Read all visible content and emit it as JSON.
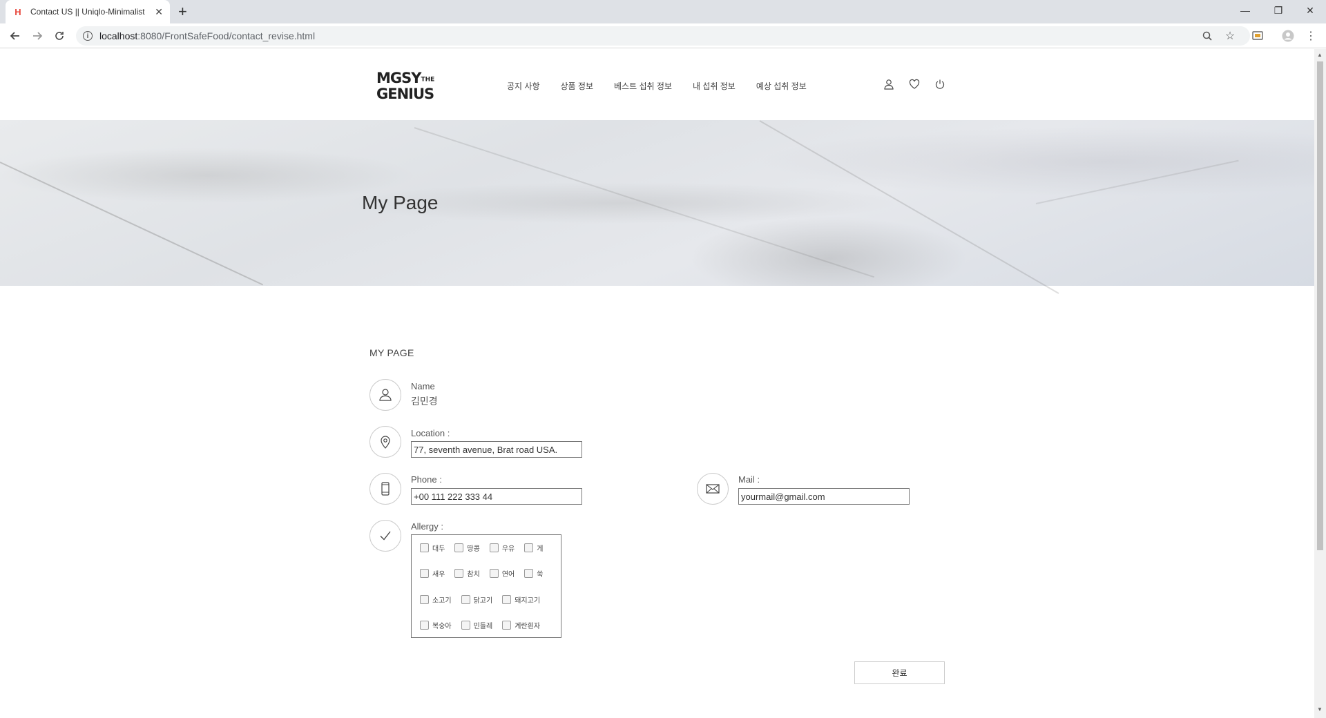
{
  "browser": {
    "tab_title": "Contact US || Uniqlo-Minimalist",
    "tab_favicon": "H",
    "url_host": "localhost",
    "url_path": ":8080/FrontSafeFood/contact_revise.html"
  },
  "site": {
    "logo_line1": "MGSY",
    "logo_the": "THE",
    "logo_line2": "GENIUS",
    "nav": [
      "공지 사항",
      "상품 정보",
      "베스트 섭취 정보",
      "내 섭취 정보",
      "예상 섭취 정보"
    ]
  },
  "hero": {
    "title": "My Page"
  },
  "mypage": {
    "section_title": "MY PAGE",
    "name_label": "Name",
    "name_value": "김민경",
    "location_label": "Location :",
    "location_value": "77, seventh avenue, Brat road USA.",
    "phone_label": "Phone :",
    "phone_value": "+00 111 222 333 44",
    "mail_label": "Mail :",
    "mail_value": "yourmail@gmail.com",
    "allergy_label": "Allergy :",
    "allergy_rows": [
      [
        "대두",
        "땅콩",
        "우유",
        "게"
      ],
      [
        "새우",
        "참치",
        "연어",
        "쑥"
      ],
      [
        "소고기",
        "닭고기",
        "돼지고기"
      ],
      [
        "복숭아",
        "민들레",
        "계란흰자"
      ]
    ],
    "submit_label": "완료"
  },
  "icons": {
    "name": "user-icon",
    "location": "map-pin-icon",
    "phone": "phone-icon",
    "mail": "mail-icon",
    "allergy": "check-icon"
  }
}
